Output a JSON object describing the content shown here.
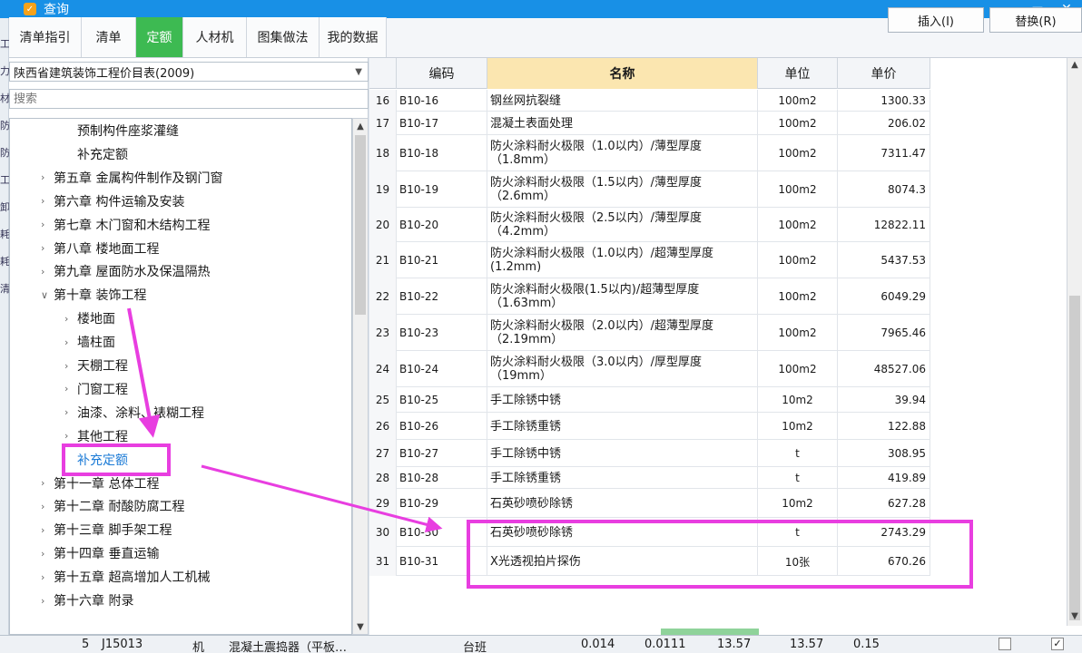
{
  "window": {
    "title": "查询",
    "icon": "app-logo-icon",
    "restore_icon": "restore-icon",
    "close_icon": "close-icon"
  },
  "tabs": [
    "清单指引",
    "清单",
    "定额",
    "人材机",
    "图集做法",
    "我的数据"
  ],
  "active_tab": "定额",
  "buttons": {
    "insert": "插入(I)",
    "replace": "替换(R)"
  },
  "library": {
    "selected": "陕西省建筑装饰工程价目表(2009)"
  },
  "search": {
    "placeholder": "搜索"
  },
  "tree": [
    {
      "label": "预制构件座浆灌缝",
      "level": 2,
      "expander": ""
    },
    {
      "label": "补充定额",
      "level": 2,
      "expander": ""
    },
    {
      "label": "第五章 金属构件制作及钢门窗",
      "level": 1,
      "expander": ">"
    },
    {
      "label": "第六章 构件运输及安装",
      "level": 1,
      "expander": ">"
    },
    {
      "label": "第七章 木门窗和木结构工程",
      "level": 1,
      "expander": ">"
    },
    {
      "label": "第八章 楼地面工程",
      "level": 1,
      "expander": ">"
    },
    {
      "label": "第九章 屋面防水及保温隔热",
      "level": 1,
      "expander": ">"
    },
    {
      "label": "第十章 装饰工程",
      "level": 1,
      "expander": "v"
    },
    {
      "label": "楼地面",
      "level": 2,
      "expander": ">"
    },
    {
      "label": "墙柱面",
      "level": 2,
      "expander": ">"
    },
    {
      "label": "天棚工程",
      "level": 2,
      "expander": ">"
    },
    {
      "label": "门窗工程",
      "level": 2,
      "expander": ">"
    },
    {
      "label": "油漆、涂料、裱糊工程",
      "level": 2,
      "expander": ">"
    },
    {
      "label": "其他工程",
      "level": 2,
      "expander": ">"
    },
    {
      "label": "补充定额",
      "level": 2,
      "expander": "",
      "selected": true
    },
    {
      "label": "第十一章 总体工程",
      "level": 1,
      "expander": ">"
    },
    {
      "label": "第十二章 耐酸防腐工程",
      "level": 1,
      "expander": ">"
    },
    {
      "label": "第十三章 脚手架工程",
      "level": 1,
      "expander": ">"
    },
    {
      "label": "第十四章 垂直运输",
      "level": 1,
      "expander": ">"
    },
    {
      "label": "第十五章 超高增加人工机械",
      "level": 1,
      "expander": ">"
    },
    {
      "label": "第十六章 附录",
      "level": 1,
      "expander": ">"
    }
  ],
  "table": {
    "headers": {
      "code": "编码",
      "name": "名称",
      "unit": "单位",
      "price": "单价"
    },
    "rows": [
      {
        "n": "16",
        "code": "B10-16",
        "name": "钢丝网抗裂缝",
        "unit": "100m2",
        "price": "1300.33"
      },
      {
        "n": "17",
        "code": "B10-17",
        "name": "混凝土表面处理",
        "unit": "100m2",
        "price": "206.02"
      },
      {
        "n": "18",
        "code": "B10-18",
        "name": "防火涂料耐火极限（1.0以内）/薄型厚度（1.8mm）",
        "unit": "100m2",
        "price": "7311.47"
      },
      {
        "n": "19",
        "code": "B10-19",
        "name": "防火涂料耐火极限（1.5以内）/薄型厚度（2.6mm）",
        "unit": "100m2",
        "price": "8074.3"
      },
      {
        "n": "20",
        "code": "B10-20",
        "name": "防火涂料耐火极限（2.5以内）/薄型厚度（4.2mm）",
        "unit": "100m2",
        "price": "12822.11"
      },
      {
        "n": "21",
        "code": "B10-21",
        "name": "防火涂料耐火极限（1.0以内）/超薄型厚度(1.2mm)",
        "unit": "100m2",
        "price": "5437.53"
      },
      {
        "n": "22",
        "code": "B10-22",
        "name": "防火涂料耐火极限(1.5以内)/超薄型厚度（1.63mm）",
        "unit": "100m2",
        "price": "6049.29"
      },
      {
        "n": "23",
        "code": "B10-23",
        "name": "防火涂料耐火极限（2.0以内）/超薄型厚度（2.19mm）",
        "unit": "100m2",
        "price": "7965.46"
      },
      {
        "n": "24",
        "code": "B10-24",
        "name": "防火涂料耐火极限（3.0以内）/厚型厚度（19mm）",
        "unit": "100m2",
        "price": "48527.06"
      },
      {
        "n": "25",
        "code": "B10-25",
        "name": "手工除锈中锈",
        "unit": "10m2",
        "price": "39.94"
      },
      {
        "n": "26",
        "code": "B10-26",
        "name": "手工除锈重锈",
        "unit": "10m2",
        "price": "122.88"
      },
      {
        "n": "27",
        "code": "B10-27",
        "name": "手工除锈中锈",
        "unit": "t",
        "price": "308.95"
      },
      {
        "n": "28",
        "code": "B10-28",
        "name": "手工除锈重锈",
        "unit": "t",
        "price": "419.89"
      },
      {
        "n": "29",
        "code": "B10-29",
        "name": "石英砂喷砂除锈",
        "unit": "10m2",
        "price": "627.28"
      },
      {
        "n": "30",
        "code": "B10-30",
        "name": "石英砂喷砂除锈",
        "unit": "t",
        "price": "2743.29"
      },
      {
        "n": "31",
        "code": "B10-31",
        "name": "X光透视拍片探伤",
        "unit": "10张",
        "price": "670.26"
      }
    ]
  },
  "bottom_row": {
    "n": "5",
    "code": "J15013",
    "type": "机",
    "name": "混凝土震捣器（平板…",
    "unit": "台班",
    "v1": "0.014",
    "v2": "0.0111",
    "v3": "13.57",
    "v4": "13.57",
    "v5": "0.15"
  },
  "outer_strip_chars": [
    "工",
    "力",
    "材",
    "防",
    "防",
    "工",
    "卸",
    "耗",
    "耗",
    "清"
  ],
  "colors": {
    "title_bar": "#1890e6",
    "active_tab": "#3dba52",
    "highlight": "#e83ee0",
    "header_hl": "#fbe6b0"
  }
}
